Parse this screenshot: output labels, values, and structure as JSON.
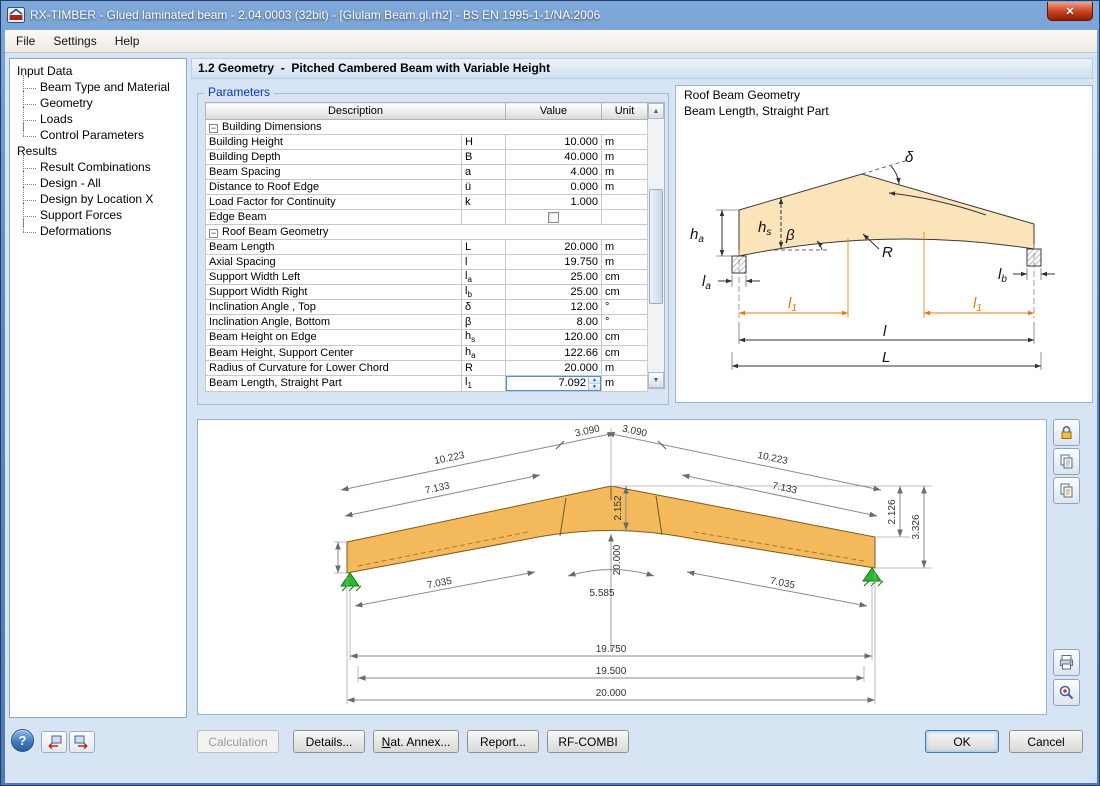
{
  "glyphs": {
    "close": "✕",
    "help": "?",
    "up": "▲",
    "down": "▼",
    "collapse": "−"
  },
  "icons": {
    "app_icon": "rx-timber-logo",
    "close_button": "close-x-icon",
    "lock_button": "padlock-icon",
    "copy_view_button": "copy-page-icon",
    "save_view_button": "copy-page-icon",
    "print_graphic_button": "printer-icon",
    "zoom_button": "mag​nifier-icon",
    "help_button": "question-mark-icon",
    "nav_previous_button": "window-arrow-left-icon",
    "nav_next_button": "window-arrow-right-icon"
  },
  "window": {
    "title": "RX-TIMBER - Glued laminated beam - 2.04.0003 (32bit) - [Glulam Beam.gl.rh2] - BS EN 1995-1-1/NA:2006"
  },
  "menu": {
    "items": [
      "File",
      "Settings",
      "Help"
    ]
  },
  "sidebar": {
    "sections": [
      {
        "label": "Input Data",
        "items": [
          "Beam Type and Material",
          "Geometry",
          "Loads",
          "Control Parameters"
        ]
      },
      {
        "label": "Results",
        "items": [
          "Result Combinations",
          "Design - All",
          "Design by Location X",
          "Support Forces",
          "Deformations"
        ]
      }
    ]
  },
  "content_header": {
    "title": "1.2 Geometry  -  Pitched Cambered Beam with Variable Height"
  },
  "parameters": {
    "label": "Parameters",
    "columns": {
      "description": "Description",
      "value": "Value",
      "unit": "Unit"
    },
    "rows": [
      {
        "type": "group",
        "description": "Building Dimensions"
      },
      {
        "type": "item",
        "description": "Building Height",
        "sym": "H",
        "value": "10.000",
        "unit": "m"
      },
      {
        "type": "item",
        "description": "Building Depth",
        "sym": "B",
        "value": "40.000",
        "unit": "m"
      },
      {
        "type": "item",
        "description": "Beam Spacing",
        "sym": "a",
        "value": "4.000",
        "unit": "m"
      },
      {
        "type": "item",
        "description": "Distance to Roof Edge",
        "sym": "ü",
        "value": "0.000",
        "unit": "m"
      },
      {
        "type": "item",
        "description": "Load Factor for Continuity",
        "sym": "k",
        "value": "1.000",
        "unit": ""
      },
      {
        "type": "item",
        "description": "Edge Beam",
        "sym": "",
        "control": "checkbox",
        "checked": false,
        "unit": ""
      },
      {
        "type": "group",
        "description": "Roof Beam Geometry"
      },
      {
        "type": "item",
        "description": "Beam Length",
        "sym": "L",
        "value": "20.000",
        "unit": "m"
      },
      {
        "type": "item",
        "description": "Axial Spacing",
        "sym": "l",
        "value": "19.750",
        "unit": "m"
      },
      {
        "type": "item",
        "description": "Support Width Left",
        "sym": "l",
        "sub": "a",
        "value": "25.00",
        "unit": "cm"
      },
      {
        "type": "item",
        "description": "Support Width Right",
        "sym": "l",
        "sub": "b",
        "value": "25.00",
        "unit": "cm"
      },
      {
        "type": "item",
        "description": "Inclination Angle , Top",
        "sym": "δ",
        "value": "12.00",
        "unit": "°"
      },
      {
        "type": "item",
        "description": "Inclination Angle, Bottom",
        "sym": "β",
        "value": "8.00",
        "unit": "°"
      },
      {
        "type": "item",
        "description": "Beam Height on Edge",
        "sym": "h",
        "sub": "s",
        "value": "120.00",
        "unit": "cm"
      },
      {
        "type": "item",
        "description": "Beam Height, Support Center",
        "sym": "h",
        "sub": "a",
        "value": "122.66",
        "unit": "cm"
      },
      {
        "type": "item",
        "description": "Radius of Curvature for Lower Chord",
        "sym": "R",
        "value": "20.000",
        "unit": "m"
      },
      {
        "type": "item",
        "description": "Beam Length, Straight Part",
        "sym": "l",
        "sub": "1",
        "control": "spinner",
        "value": "7.092",
        "unit": "m",
        "selected": true
      }
    ]
  },
  "info_panel": {
    "line1": "Roof Beam Geometry",
    "line2": "Beam Length, Straight Part"
  },
  "diagram": {
    "labels": {
      "delta": "δ",
      "beta": "β",
      "R": "R",
      "h": "h",
      "l": "l",
      "L": "L",
      "sub_a": "a",
      "sub_s": "s",
      "sub_b": "b",
      "sub_1": "1"
    },
    "accent_color": "#e07a10"
  },
  "drawing": {
    "dims": {
      "top_left_outer": "10.223",
      "top_left_inner": "3.090",
      "top_right_inner": "3.090",
      "top_right_outer": "10.223",
      "slope_left": "7.133",
      "slope_right": "7.133",
      "apex_depth": "2.152",
      "right_rise": "2.126",
      "right_total": "3.326",
      "radius": "20.000",
      "arc_length": "5.585",
      "lower_left": "7.035",
      "lower_right": "7.035",
      "axial_span": "19.750",
      "clear_span": "19.500",
      "total_span": "20.000"
    }
  },
  "footer": {
    "calculation": "Calculation",
    "details": "Details...",
    "nat_annex": "Nat. Annex...",
    "report": "Report...",
    "rf_combi": "RF-COMBI",
    "ok": "OK",
    "cancel": "Cancel"
  }
}
